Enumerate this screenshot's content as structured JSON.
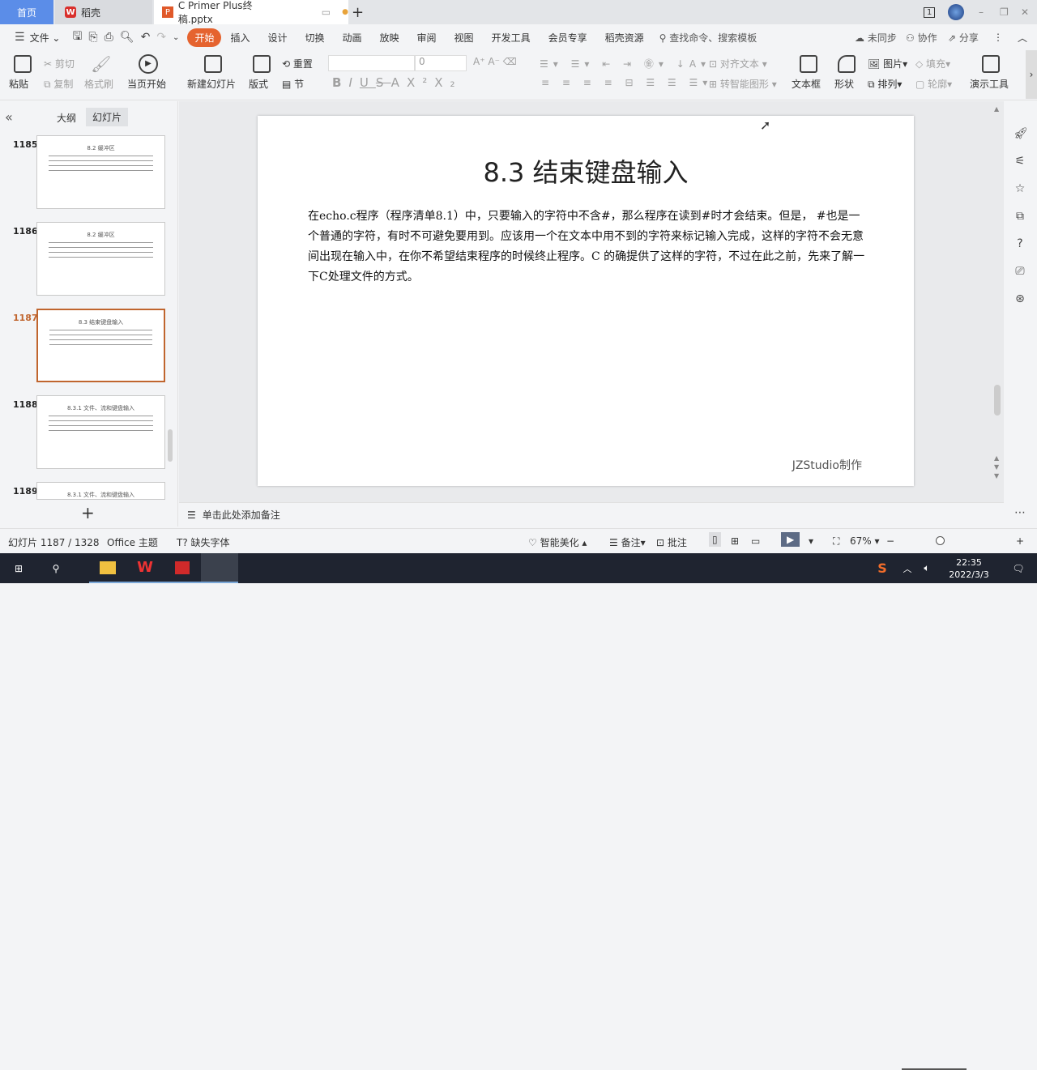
{
  "tabs": {
    "home": "首页",
    "daoke": "稻壳",
    "doc": "C Primer  Plus终稿.pptx",
    "new_tab": "+"
  },
  "window": {
    "page_indicator": "1",
    "minimize": "–",
    "restore": "❐",
    "close": "✕"
  },
  "menu": {
    "file": "文件",
    "items": [
      "开始",
      "插入",
      "设计",
      "切换",
      "动画",
      "放映",
      "审阅",
      "视图",
      "开发工具",
      "会员专享",
      "稻壳资源"
    ],
    "active": "开始",
    "search_placeholder": "查找命令、搜索模板",
    "sync": "未同步",
    "collab": "协作",
    "share": "分享"
  },
  "ribbon": {
    "paste": "粘贴",
    "cut": "剪切",
    "copy": "复制",
    "format_painter": "格式刷",
    "play_from_current": "当页开始",
    "new_slide": "新建幻灯片",
    "layout": "版式",
    "reset": "重置",
    "section": "节",
    "font_name": "",
    "font_size": "0",
    "bold": "B",
    "italic": "I",
    "underline": "U",
    "strike": "S",
    "font_color": "A",
    "superscript": "X²",
    "subscript": "X₂",
    "align_text": "对齐文本",
    "convert_smartart": "转智能图形",
    "textbox": "文本框",
    "shape": "形状",
    "picture": "图片",
    "arrange": "排列",
    "fill": "填充",
    "outline": "轮廓",
    "presentation_tools": "演示工具"
  },
  "left_panel": {
    "outline_tab": "大纲",
    "slides_tab": "幻灯片",
    "slides": [
      {
        "num": "1185",
        "title": "8.2 缓冲区",
        "selected": false
      },
      {
        "num": "1186",
        "title": "8.2 缓冲区",
        "selected": false
      },
      {
        "num": "1187",
        "title": "8.3 结束键盘输入",
        "selected": true
      },
      {
        "num": "1188",
        "title": "8.3.1 文件、流和键盘输入",
        "selected": false
      },
      {
        "num": "1189",
        "title": "8.3.1 文件、流和键盘输入",
        "selected": false
      }
    ],
    "add": "+"
  },
  "slide": {
    "title": "8.3 结束键盘输入",
    "body": "在echo.c程序（程序清单8.1）中，只要输入的字符中不含#，那么程序在读到#时才会结束。但是， #也是一个普通的字符，有时不可避免要用到。应该用一个在文本中用不到的字符来标记输入完成，这样的字符不会无意间出现在输入中，在你不希望结束程序的时候终止程序。C 的确提供了这样的字符，不过在此之前，先来了解一下C处理文件的方式。",
    "footer": "JZStudio制作"
  },
  "notes": {
    "placeholder": "单击此处添加备注"
  },
  "status": {
    "slide_counter": "幻灯片 1187 / 1328",
    "theme": "Office 主题",
    "missing_font": "缺失字体",
    "beautify": "智能美化",
    "notes": "备注",
    "comment": "批注",
    "zoom": "67%",
    "zoom_fraction": 0.67
  },
  "taskbar": {
    "time": "22:35",
    "date": "2022/3/3"
  },
  "colors": {
    "accent": "#e5632f",
    "selected_thumb": "#c0652e",
    "home_tab": "#5b8de8",
    "taskbar": "#1f2430"
  }
}
